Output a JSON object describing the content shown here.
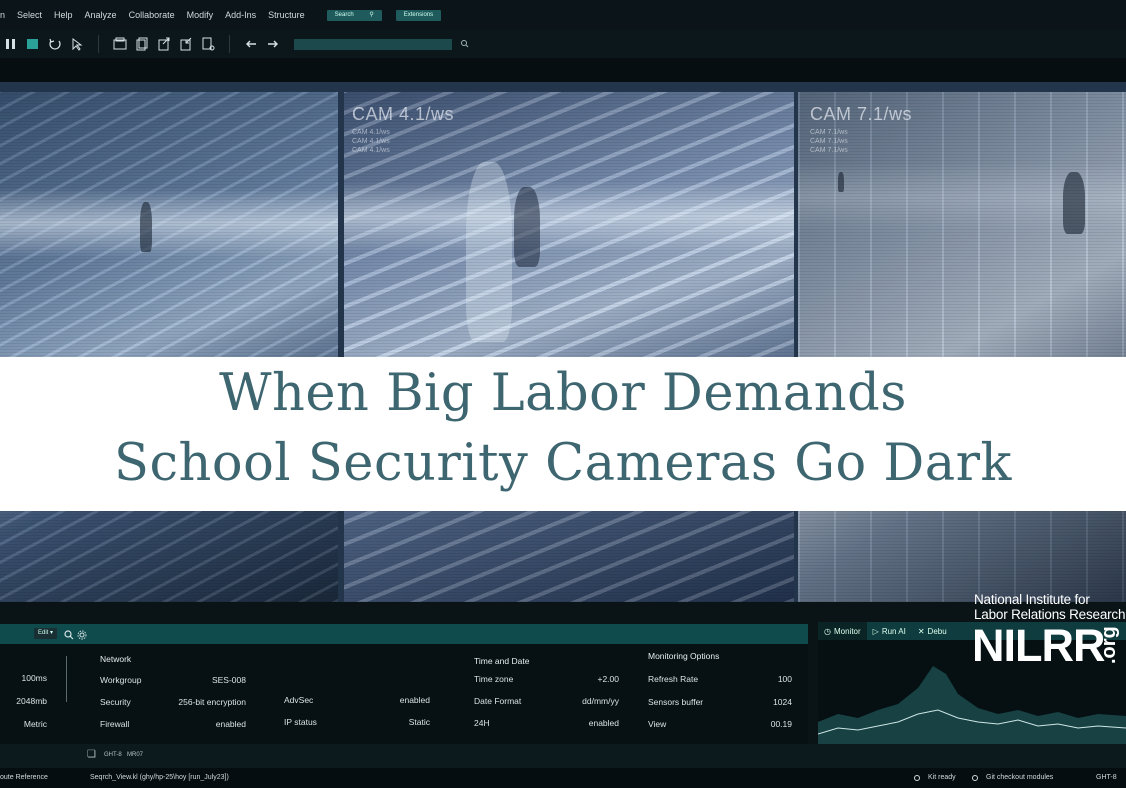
{
  "menu": {
    "items": [
      "n",
      "Select",
      "Help",
      "Analyze",
      "Collaborate",
      "Modify",
      "Add-Ins",
      "Structure"
    ],
    "search_label": "Search",
    "extensions_label": "Extensions"
  },
  "cameras": [
    {
      "label": "",
      "sub": ""
    },
    {
      "label": "CAM 4.1/ws",
      "sub": "CAM 4.1/ws\nCAM 4.1/ws\nCAM 4.1/ws"
    },
    {
      "label": "CAM 7.1/ws",
      "sub": "CAM 7.1/ws\nCAM 7.1/ws\nCAM 7.1/ws"
    }
  ],
  "headline": {
    "line1": "When Big Labor Demands",
    "line2": "School Security Cameras Go Dark"
  },
  "panel": {
    "edit_label": "Edit",
    "left_values": [
      "100ms",
      "2048mb",
      "Metric"
    ],
    "network": {
      "title": "Network",
      "rows": [
        {
          "label": "Workgroup",
          "value": "SES-008"
        },
        {
          "label": "Security",
          "value": "256-bit encryption"
        },
        {
          "label": "Firewall",
          "value": "enabled"
        }
      ]
    },
    "advanced": {
      "rows": [
        {
          "label": "AdvSec",
          "value": "enabled"
        },
        {
          "label": "IP status",
          "value": "Static"
        }
      ]
    },
    "time": {
      "title": "Time and Date",
      "rows": [
        {
          "label": "Time zone",
          "value": "+2.00"
        },
        {
          "label": "Date Format",
          "value": "dd/mm/yy"
        },
        {
          "label": "24H",
          "value": "enabled"
        }
      ]
    },
    "monitoring": {
      "title": "Monitoring Options",
      "rows": [
        {
          "label": "Refresh Rate",
          "value": "100"
        },
        {
          "label": "Sensors buffer",
          "value": "1024"
        },
        {
          "label": "View",
          "value": "00.19"
        }
      ]
    }
  },
  "monitor": {
    "tabs": [
      "Monitor",
      "Run AI",
      "Debu"
    ]
  },
  "logo": {
    "line1": "National Institute for",
    "line2": "Labor Relations Research",
    "mark": "NILRR",
    "suffix": ".org"
  },
  "mini": {
    "a": "GHT-8",
    "b": "MR07"
  },
  "status": {
    "left": "oute Reference",
    "search_view": "Seqrch_View.kl (ghy/hp-25\\hoy [run_July23])",
    "kit": "Kit ready",
    "git": "Git checkout modules",
    "right": "GHT-8"
  },
  "colors": {
    "headline_text": "#3e6670",
    "accent_teal": "#0f4a4c",
    "background": "#0a1418"
  }
}
